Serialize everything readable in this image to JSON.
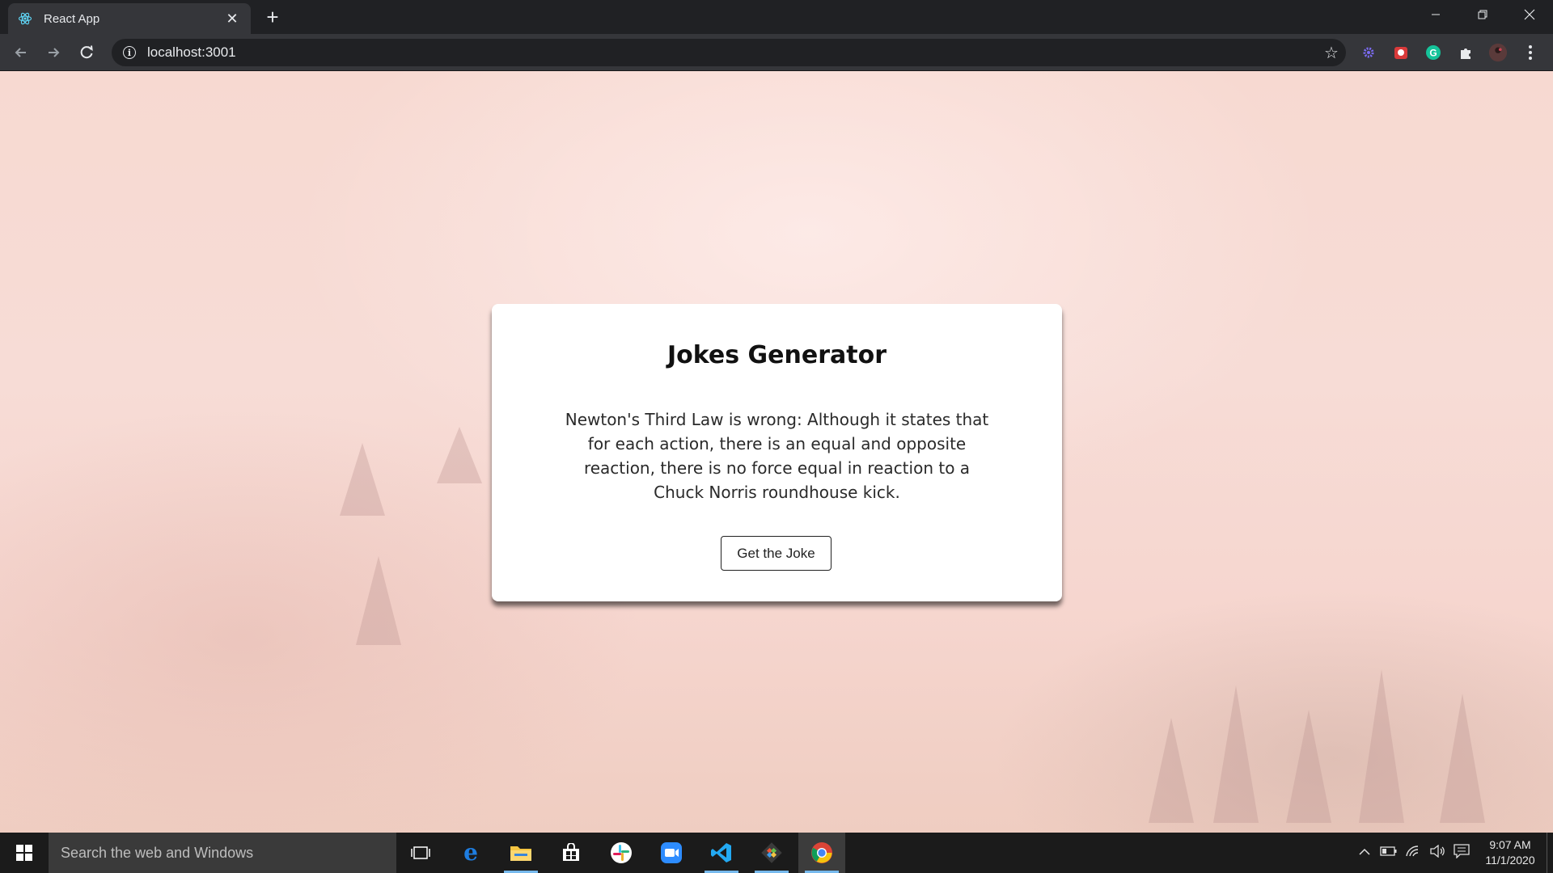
{
  "browser": {
    "tab": {
      "title": "React App",
      "favicon": "react-logo-icon",
      "close_icon": "close-icon"
    },
    "new_tab_icon": "plus-icon",
    "window_controls": [
      "minimize-icon",
      "restore-icon",
      "close-icon"
    ],
    "toolbar": {
      "back_icon": "back-arrow-icon",
      "forward_icon": "forward-arrow-icon",
      "reload_icon": "reload-icon",
      "site_info_icon": "info-icon",
      "url": "localhost:3001",
      "bookmark_icon": "star-icon",
      "extensions": [
        "purple-gear-extension-icon",
        "red-extension-icon",
        "grammarly-icon",
        "puzzle-extensions-icon",
        "profile-avatar"
      ],
      "menu_icon": "kebab-menu-icon"
    }
  },
  "app": {
    "title": "Jokes Generator",
    "joke": "Newton's Third Law is wrong: Although it states that for each action, there is an equal and opposite reaction, there is no force equal in reaction to a Chuck Norris roundhouse kick.",
    "button_label": "Get the Joke"
  },
  "taskbar": {
    "search_placeholder": "Search the web and Windows",
    "apps": [
      "task-view-icon",
      "edge-icon",
      "file-explorer-icon",
      "store-icon",
      "slack-icon",
      "zoom-icon",
      "vscode-icon",
      "git-icon",
      "chrome-icon"
    ],
    "tray_icons": [
      "chevron-up-icon",
      "battery-icon",
      "wifi-icon",
      "volume-icon",
      "notifications-icon"
    ],
    "time": "9:07 AM",
    "date": "11/1/2020"
  },
  "colors": {
    "chrome_dark": "#202124",
    "chrome_toolbar": "#35363a",
    "page_background": "#f6d8d2",
    "card_background": "#ffffff",
    "taskbar": "#1b1b1b"
  }
}
